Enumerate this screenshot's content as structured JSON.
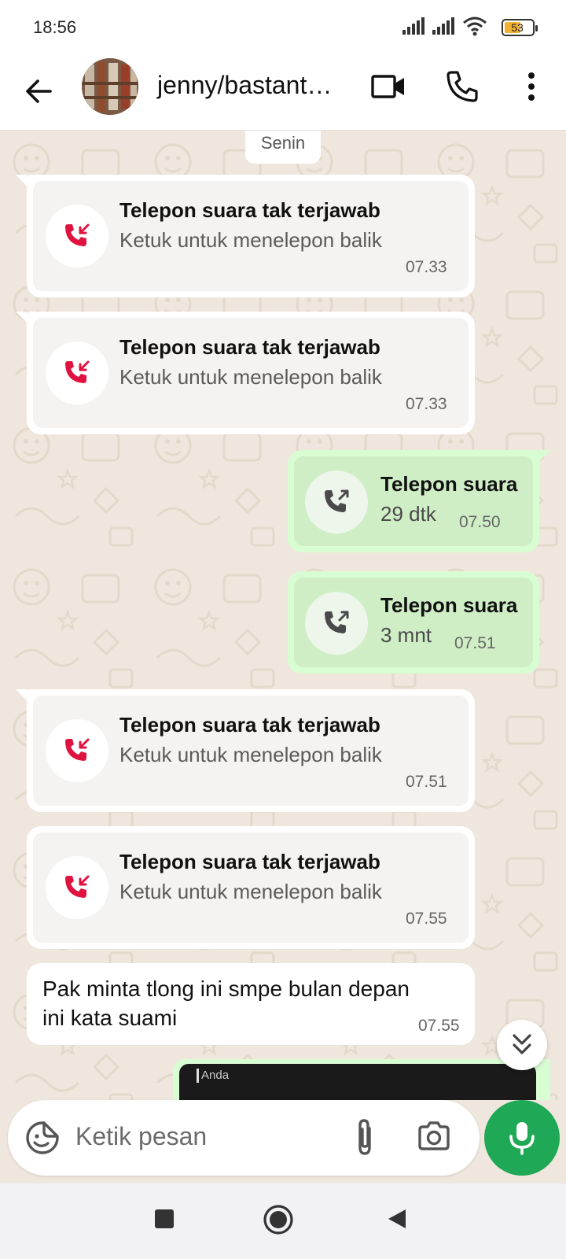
{
  "status_bar": {
    "time": "18:56",
    "battery": "53",
    "icons": [
      "signal-icon",
      "signal-icon",
      "wifi-icon",
      "battery-icon"
    ]
  },
  "header": {
    "contact_name": "jenny/bastant…",
    "icons": [
      "back-arrow-icon",
      "video-call-icon",
      "voice-call-icon",
      "more-options-icon"
    ]
  },
  "chat": {
    "date_chip": "Senin",
    "messages": [
      {
        "type": "missed_call",
        "direction": "in",
        "title": "Telepon suara tak terjawab",
        "subtitle": "Ketuk untuk menelepon balik",
        "time": "07.33"
      },
      {
        "type": "missed_call",
        "direction": "in",
        "title": "Telepon suara tak terjawab",
        "subtitle": "Ketuk untuk menelepon balik",
        "time": "07.33"
      },
      {
        "type": "call",
        "direction": "out",
        "title": "Telepon suara",
        "subtitle": "29 dtk",
        "time": "07.50"
      },
      {
        "type": "call",
        "direction": "out",
        "title": "Telepon suara",
        "subtitle": "3 mnt",
        "time": "07.51"
      },
      {
        "type": "missed_call",
        "direction": "in",
        "title": "Telepon suara tak terjawab",
        "subtitle": "Ketuk untuk menelepon balik",
        "time": "07.51"
      },
      {
        "type": "missed_call",
        "direction": "in",
        "title": "Telepon suara tak terjawab",
        "subtitle": "Ketuk untuk menelepon balik",
        "time": "07.55"
      },
      {
        "type": "text",
        "direction": "in",
        "text": "Pak minta tlong ini smpe bulan depan ini kata suami",
        "time": "07.55"
      }
    ],
    "partial_reply_label": "Anda"
  },
  "input": {
    "placeholder": "Ketik pesan",
    "icons": [
      "sticker-icon",
      "attach-icon",
      "camera-icon",
      "mic-icon"
    ]
  },
  "colors": {
    "incoming_bubble": "#ffffff",
    "outgoing_bubble": "#d9fdd3",
    "missed_call_red": "#e0123f",
    "mic_green": "#1fa855",
    "chat_background": "#efe7dd"
  }
}
